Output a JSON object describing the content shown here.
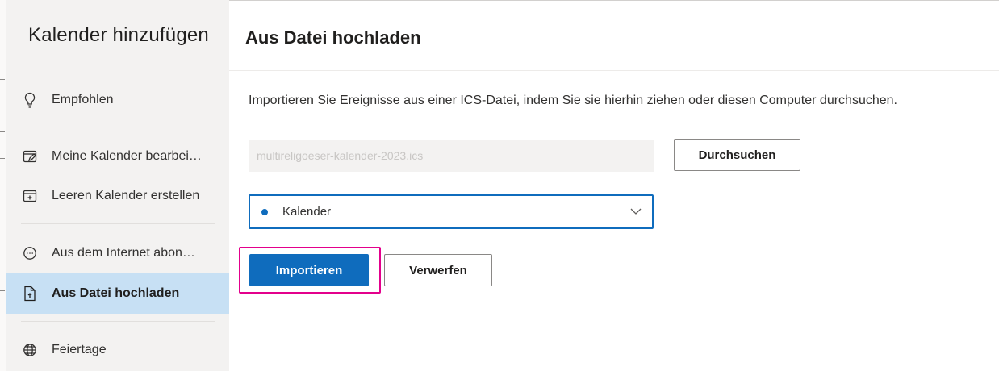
{
  "sidebar": {
    "title": "Kalender hinzufügen",
    "items": [
      {
        "label": "Empfohlen",
        "icon": "lightbulb-icon"
      },
      {
        "label": "Meine Kalender bearbei…",
        "icon": "edit-calendar-icon"
      },
      {
        "label": "Leeren Kalender erstellen",
        "icon": "add-calendar-icon"
      },
      {
        "label": "Aus dem Internet abon…",
        "icon": "subscribe-icon"
      },
      {
        "label": "Aus Datei hochladen",
        "icon": "upload-file-icon",
        "active": true
      },
      {
        "label": "Feiertage",
        "icon": "globe-icon"
      }
    ]
  },
  "main": {
    "title": "Aus Datei hochladen",
    "instructions": "Importieren Sie Ereignisse aus einer ICS-Datei, indem Sie sie hierhin ziehen oder diesen Computer durchsuchen.",
    "file_field": {
      "placeholder": "multireligoeser-kalender-2023.ics"
    },
    "browse_label": "Durchsuchen",
    "calendar_select": {
      "value": "Kalender",
      "color": "#0f6cbd"
    },
    "import_label": "Importieren",
    "discard_label": "Verwerfen"
  },
  "colors": {
    "accent": "#0f6cbd",
    "active_item_bg": "#c7e0f4",
    "highlight_border": "#e3008c"
  }
}
